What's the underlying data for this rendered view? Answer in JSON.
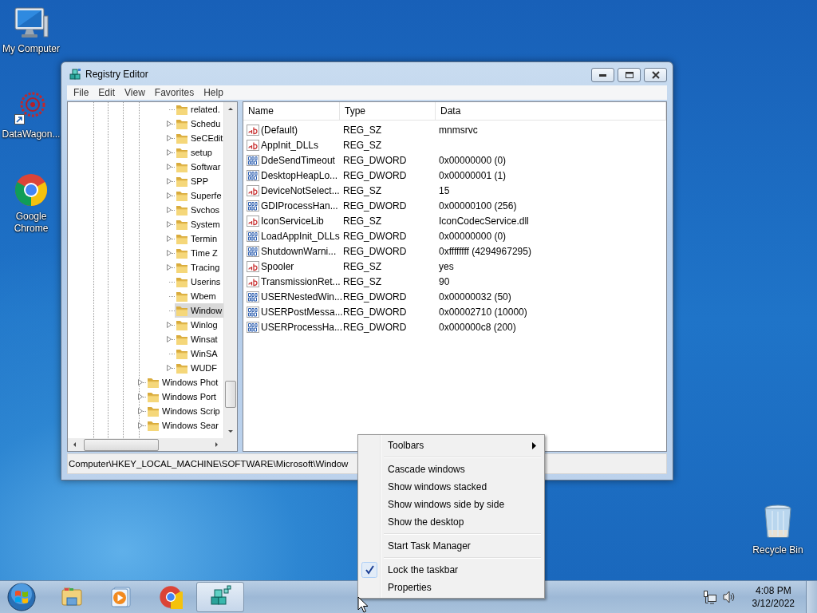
{
  "desktop_icons": [
    {
      "kind": "computer",
      "label": "My Computer"
    },
    {
      "kind": "shortcut",
      "label": "DataWagon..."
    },
    {
      "kind": "browser",
      "label": "Google Chrome"
    },
    {
      "kind": "recycle",
      "label": "Recycle Bin"
    }
  ],
  "window": {
    "title": "Registry Editor",
    "menu": [
      "File",
      "Edit",
      "View",
      "Favorites",
      "Help"
    ],
    "tree": {
      "items": [
        {
          "children": [
            {
              "label": "related.",
              "expandable": false,
              "selected": false
            },
            {
              "label": "Schedu",
              "expandable": true,
              "selected": false
            },
            {
              "label": "SeCEdit",
              "expandable": true,
              "selected": false
            },
            {
              "label": "setup",
              "expandable": true,
              "selected": false
            },
            {
              "label": "Softwar",
              "expandable": true,
              "selected": false
            },
            {
              "label": "SPP",
              "expandable": true,
              "selected": false
            },
            {
              "label": "Superfe",
              "expandable": true,
              "selected": false
            },
            {
              "label": "Svchos",
              "expandable": true,
              "selected": false
            },
            {
              "label": "System",
              "expandable": true,
              "selected": false
            },
            {
              "label": "Termin",
              "expandable": true,
              "selected": false
            },
            {
              "label": "Time Z",
              "expandable": true,
              "selected": false
            },
            {
              "label": "Tracing",
              "expandable": true,
              "selected": false
            },
            {
              "label": "Userins",
              "expandable": false,
              "selected": false
            },
            {
              "label": "Wbem",
              "expandable": false,
              "selected": false
            },
            {
              "label": "Window",
              "expandable": false,
              "selected": true
            },
            {
              "label": "Winlog",
              "expandable": true,
              "selected": false
            },
            {
              "label": "Winsat",
              "expandable": true,
              "selected": false
            },
            {
              "label": "WinSA",
              "expandable": false,
              "selected": false
            },
            {
              "label": "WUDF",
              "expandable": true,
              "selected": false
            }
          ]
        },
        {
          "label": "Windows Phot",
          "expandable": true,
          "selected": false
        },
        {
          "label": "Windows Port",
          "expandable": true,
          "selected": false
        },
        {
          "label": "Windows Scrip",
          "expandable": true,
          "selected": false
        },
        {
          "label": "Windows Sear",
          "expandable": true,
          "selected": false
        }
      ]
    },
    "list": {
      "columns": [
        "Name",
        "Type",
        "Data"
      ],
      "rows": [
        {
          "kind": "sz",
          "name": "(Default)",
          "type": "REG_SZ",
          "data": "mnmsrvc"
        },
        {
          "kind": "sz",
          "name": "AppInit_DLLs",
          "type": "REG_SZ"
        },
        {
          "kind": "dword",
          "name": "DdeSendTimeout",
          "type": "REG_DWORD",
          "data": "0x00000000 (0)"
        },
        {
          "kind": "dword",
          "name": "DesktopHeapLo...",
          "type": "REG_DWORD",
          "data": "0x00000001 (1)"
        },
        {
          "kind": "sz",
          "name": "DeviceNotSelect...",
          "type": "REG_SZ",
          "data": "15"
        },
        {
          "kind": "dword",
          "name": "GDIProcessHan...",
          "type": "REG_DWORD",
          "data": "0x00000100 (256)"
        },
        {
          "kind": "sz",
          "name": "IconServiceLib",
          "type": "REG_SZ",
          "data": "IconCodecService.dll"
        },
        {
          "kind": "dword",
          "name": "LoadAppInit_DLLs",
          "type": "REG_DWORD",
          "data": "0x00000000 (0)"
        },
        {
          "kind": "dword",
          "name": "ShutdownWarni...",
          "type": "REG_DWORD",
          "data": "0xffffffff (4294967295)"
        },
        {
          "kind": "sz",
          "name": "Spooler",
          "type": "REG_SZ",
          "data": "yes"
        },
        {
          "kind": "sz",
          "name": "TransmissionRet...",
          "type": "REG_SZ",
          "data": "90"
        },
        {
          "kind": "dword",
          "name": "USERNestedWin...",
          "type": "REG_DWORD",
          "data": "0x00000032 (50)"
        },
        {
          "kind": "dword",
          "name": "USERPostMessa...",
          "type": "REG_DWORD",
          "data": "0x00002710 (10000)"
        },
        {
          "kind": "dword",
          "name": "USERProcessHa...",
          "type": "REG_DWORD",
          "data": "0x000000c8 (200)"
        }
      ]
    },
    "status_bar": "Computer\\HKEY_LOCAL_MACHINE\\SOFTWARE\\Microsoft\\Window"
  },
  "context_menu": {
    "groups": [
      [
        {
          "label": "Toolbars",
          "submenu": true,
          "checked": false
        }
      ],
      [
        {
          "label": "Cascade windows",
          "submenu": false,
          "checked": false
        },
        {
          "label": "Show windows stacked",
          "submenu": false,
          "checked": false
        },
        {
          "label": "Show windows side by side",
          "submenu": false,
          "checked": false
        },
        {
          "label": "Show the desktop",
          "submenu": false,
          "checked": false
        }
      ],
      [
        {
          "label": "Start Task Manager",
          "submenu": false,
          "checked": false
        }
      ],
      [
        {
          "label": "Lock the taskbar",
          "submenu": false,
          "checked": true
        },
        {
          "label": "Properties",
          "submenu": false,
          "checked": false
        }
      ]
    ]
  },
  "taskbar": {
    "items": [
      {
        "kind": "explorer",
        "selected": false
      },
      {
        "kind": "media",
        "selected": false
      },
      {
        "kind": "browser",
        "selected": false
      },
      {
        "kind": "registry",
        "selected": true
      }
    ],
    "tray": {
      "time": "4:08 PM",
      "date": "3/12/2022"
    }
  }
}
